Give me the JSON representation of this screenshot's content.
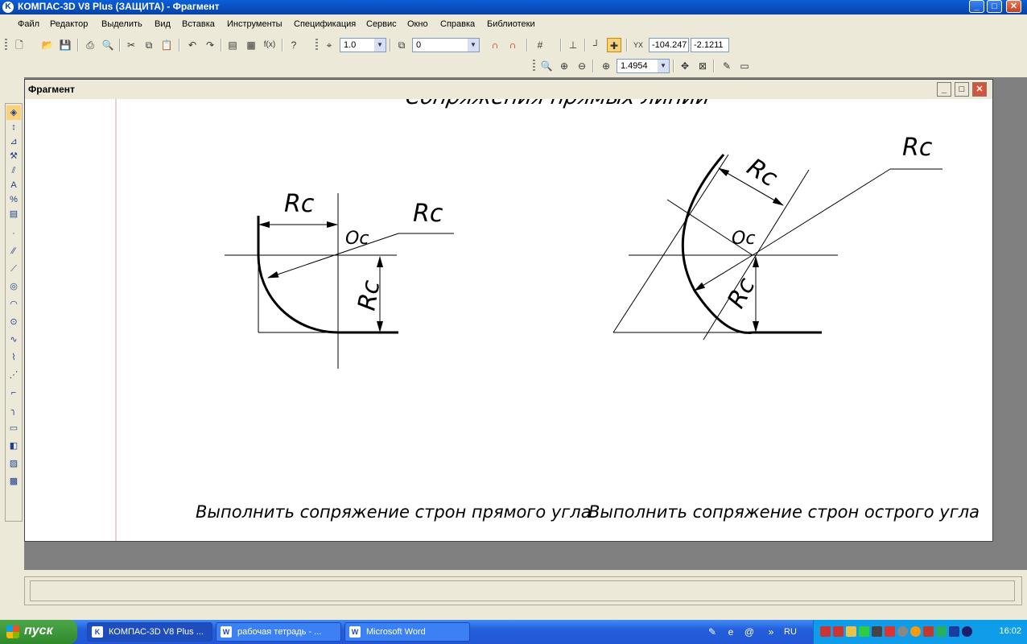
{
  "window": {
    "title": "КОМПАС-3D V8 Plus (ЗАЩИТА) - Фрагмент",
    "icon": "kompas-logo-icon"
  },
  "window_controls": {
    "minimize": "_",
    "maximize": "□",
    "close": "✕"
  },
  "menu": [
    "Файл",
    "Редактор",
    "Выделить",
    "Вид",
    "Вставка",
    "Инструменты",
    "Спецификация",
    "Сервис",
    "Окно",
    "Справка",
    "Библиотеки"
  ],
  "toolbar": {
    "step_value": "1.0",
    "layer_value": "0",
    "cursor_x": "-104.247",
    "cursor_y": "-2.1211",
    "zoom_value": "1.4954"
  },
  "fragment": {
    "title": "Фрагмент"
  },
  "drawing": {
    "heading": "Сопряжения прямых линий",
    "left_caption": "Выполнить сопряжение строн прямого угла",
    "right_caption": "Выполнить сопряжение строн острого угла",
    "radius_label": "Rc",
    "center_label": "Oc"
  },
  "taskbar": {
    "start_label": "пуск",
    "tasks": [
      "КОМПАС-3D V8 Plus ...",
      "рабочая тетрадь - ...",
      "Microsoft Word"
    ],
    "language": "RU",
    "clock": "16:02"
  },
  "colors": {
    "titlebar": "#0842a6",
    "taskbar": "#245edb",
    "start": "#2f8a2c",
    "tray": "#0f9de9",
    "margin_line": "#d9a0a0"
  }
}
